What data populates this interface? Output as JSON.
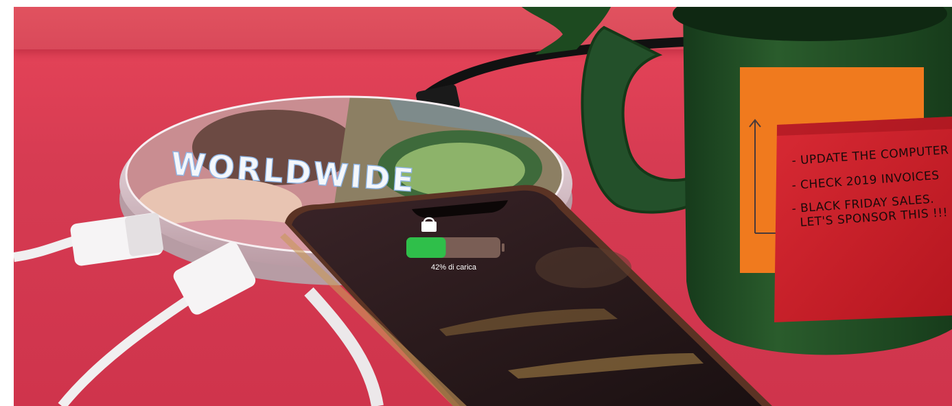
{
  "wireless_pad": {
    "printed_text": "WORLDWIDE"
  },
  "phone": {
    "battery_percent": 42,
    "battery_label": "42% di carica",
    "icon": "lock-icon"
  },
  "sticky_note": {
    "lines": [
      "- UPDATE THE COMPUTER",
      "- CHECK 2019 INVOICES",
      "- BLACK FRIDAY SALES.",
      "LET'S SPONSOR THIS !!!"
    ]
  },
  "colors": {
    "background": "#d63b52",
    "mug": "#1f4a24",
    "sticky_note": "#c81e2c",
    "mug_label": "#f07a1e",
    "battery_green": "#2fbf4a"
  }
}
